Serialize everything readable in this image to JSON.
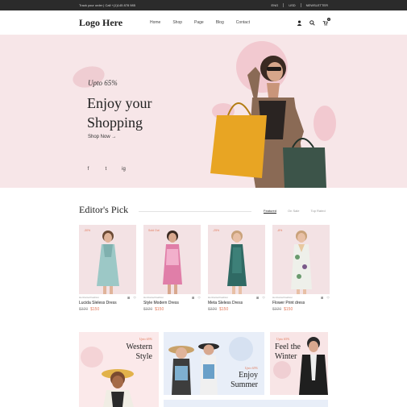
{
  "topbar": {
    "left_text": "Track your order  |  Call +(1)145 878 985",
    "lang": "ENG",
    "currency": "USD",
    "newsletter": "NEWSLETTER"
  },
  "header": {
    "logo": "Logo Here",
    "nav": [
      "Home",
      "Shop",
      "Page",
      "Blog",
      "Contact"
    ],
    "icons": [
      "user-icon",
      "search-icon",
      "cart-icon"
    ],
    "cart_count": "0"
  },
  "hero": {
    "upto": "Upto 65%",
    "headline_line1": "Enjoy your",
    "headline_line2": "Shopping",
    "shop_now": "Shop Now",
    "socials": [
      "f",
      "t",
      "ig"
    ]
  },
  "editors": {
    "title": "Editor's Pick",
    "tabs": [
      "Featured",
      "On Sale",
      "Top Rated"
    ],
    "products": [
      {
        "badge": "-30%",
        "brand": "Horizontal Fashion",
        "name": "Lucida Sleless Dress",
        "old": "$320",
        "new": "$150"
      },
      {
        "badge": "Sold Out",
        "brand": "Horizontal Fashion",
        "name": "Style Modern Dress",
        "old": "$320",
        "new": "$150"
      },
      {
        "badge": "-25%",
        "brand": "Horizontal Fashion",
        "name": "Meta Sleless Dress",
        "old": "$320",
        "new": "$150"
      },
      {
        "badge": "-8%",
        "brand": "Horizontal Fashion",
        "name": "Flower Print dress",
        "old": "$320",
        "new": "$150"
      }
    ]
  },
  "banners": {
    "b1": {
      "upto": "Upto 65%",
      "line1": "Western",
      "line2": "Style"
    },
    "b2": {
      "upto": "Upto 65%",
      "line1": "Enjoy",
      "line2": "Summer"
    },
    "b3": {
      "upto": "Upto 65%",
      "line1": "Feel the",
      "line2": "Winter"
    }
  },
  "colors": {
    "accent": "#e27a5b",
    "hero_bg": "#f7e6e8",
    "dark": "#2b2b2b"
  }
}
